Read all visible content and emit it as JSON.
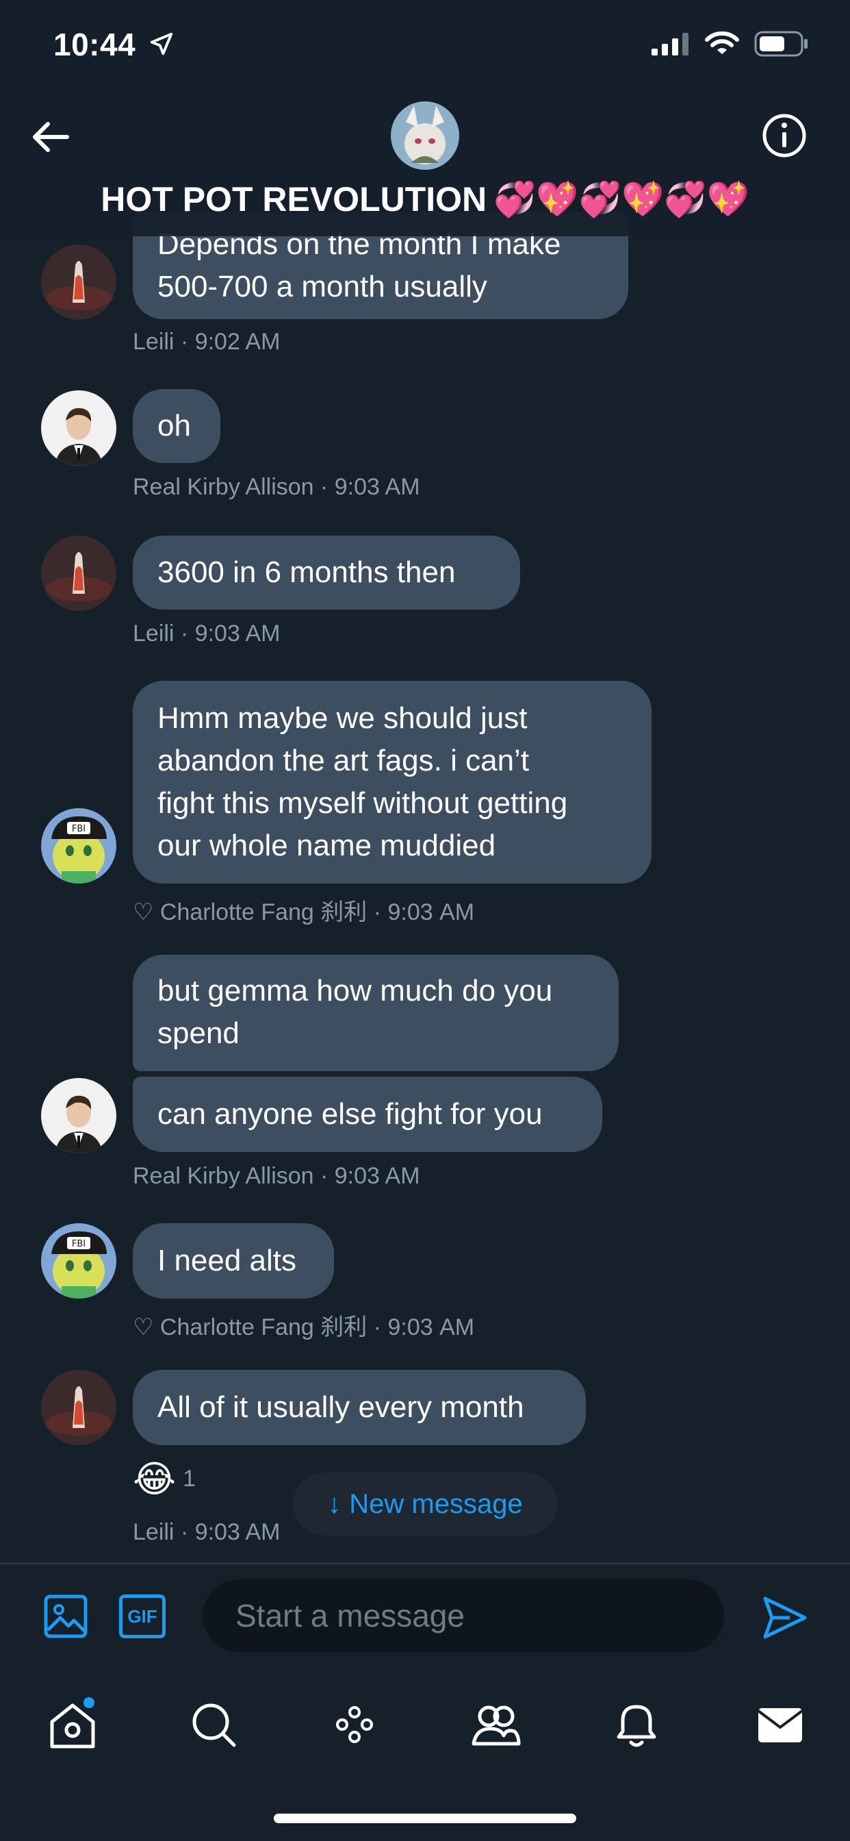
{
  "status_bar": {
    "time": "10:44"
  },
  "header": {
    "title": "HOT POT REVOLUTION",
    "title_emoji": "💞💖💞💖💞💖"
  },
  "messages": [
    {
      "text": "Depends on the month I make\n500-700 a month usually",
      "sender": "Leili",
      "time": "9:02 AM",
      "meta": "Leili · 9:02 AM"
    },
    {
      "text": "oh",
      "sender": "Real Kirby Allison",
      "meta": "Real Kirby Allison · 9:03 AM"
    },
    {
      "text": "3600 in 6 months then",
      "sender": "Leili",
      "meta": "Leili · 9:03 AM"
    },
    {
      "text": "Hmm maybe we should just\nabandon the art fags. i can’t\nfight this myself without getting\nour whole name muddied",
      "sender": "♡ Charlotte Fang 刹利",
      "meta": "♡ Charlotte Fang 刹利 · 9:03 AM"
    },
    {
      "text": "but gemma how much do you\nspend"
    },
    {
      "text": "can anyone else fight for you",
      "sender": "Real Kirby Allison",
      "meta": "Real Kirby Allison · 9:03 AM"
    },
    {
      "text": "I need alts",
      "sender": "♡ Charlotte Fang 刹利",
      "meta": "♡ Charlotte Fang 刹利 · 9:03 AM"
    },
    {
      "text": "All of it usually every month",
      "sender": "Leili",
      "meta": "Leili · 9:03 AM",
      "reaction": {
        "emoji": "😂",
        "count": "1"
      }
    }
  ],
  "new_message_pill": {
    "arrow": "↓",
    "label": "New message"
  },
  "composer": {
    "placeholder": "Start a message",
    "gif_label": "GIF"
  },
  "tabs": [
    "home-icon",
    "search-icon",
    "spaces-icon",
    "communities-icon",
    "notifications-icon",
    "messages-icon"
  ],
  "colors": {
    "background": "#15202b",
    "bubble": "#3e4e61",
    "accent": "#1d9bf0",
    "meta": "#8b98a5"
  }
}
